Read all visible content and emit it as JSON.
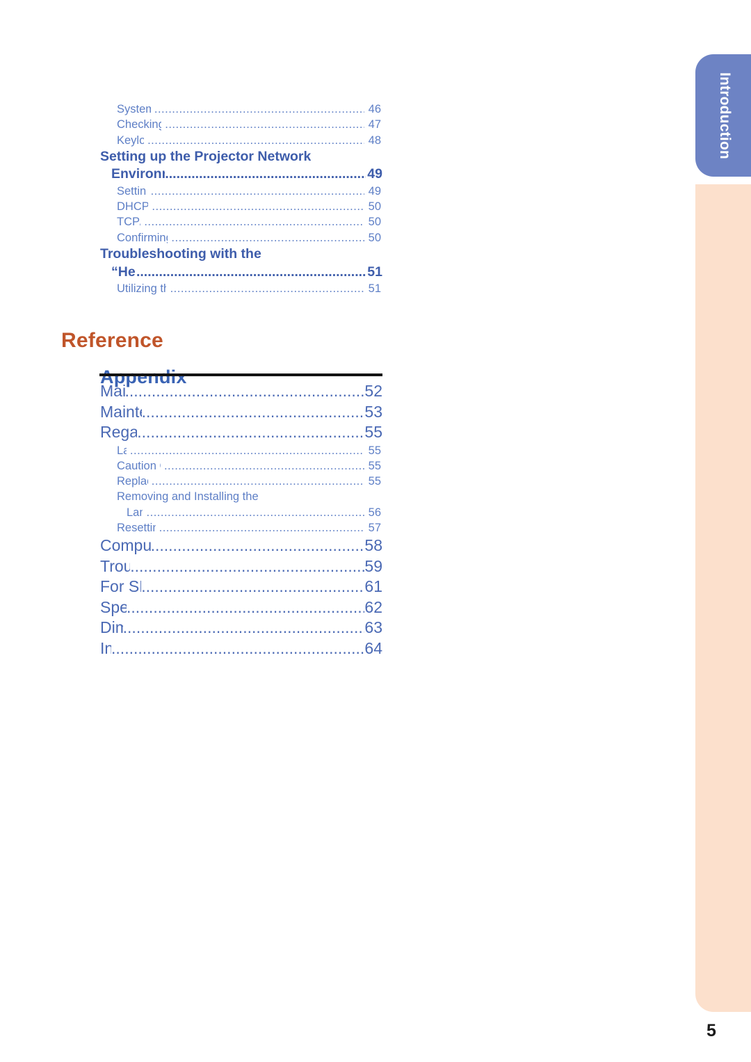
{
  "page": {
    "number": "5",
    "tab_label": "Introduction",
    "colors": {
      "tab_background": "#6d83c4",
      "side_band": "#fce0cc",
      "reference_heading": "#c0552a",
      "appendix_heading": "#3a63b4",
      "level1_bold": "#3e5dab",
      "level1_appendix": "#4a69b4",
      "level2": "#5e7fc6",
      "rule": "#141414"
    }
  },
  "headings": {
    "reference": "Reference",
    "appendix": "Appendix"
  },
  "toc": {
    "upper_entries": [
      {
        "level": 2,
        "title": "System Lock Function",
        "page": "46"
      },
      {
        "level": 2,
        "title": "Checking the Lamp Life Status",
        "page": "47"
      },
      {
        "level": 2,
        "title": "Keylock Function",
        "page": "48"
      },
      {
        "level": 1,
        "title": "Setting up the Projector Network",
        "page": "",
        "wrap_first": true
      },
      {
        "level": 1,
        "title": "Environment (“Network” Menu)",
        "page": "49",
        "continuation": true
      },
      {
        "level": 2,
        "title": "Setting a Password",
        "page": "49"
      },
      {
        "level": 2,
        "title": "DHCP Client Setting",
        "page": "50"
      },
      {
        "level": 2,
        "title": "TCP/IP Setting",
        "page": "50"
      },
      {
        "level": 2,
        "title": "Confirming the Projector Information",
        "page": "50"
      },
      {
        "level": 1,
        "title": "Troubleshooting with the",
        "page": "",
        "wrap_first": true
      },
      {
        "level": 1,
        "title": "“Help” Menu",
        "page": "51",
        "continuation": true
      },
      {
        "level": 2,
        "title": "Utilizing the “Help” Menu Functions",
        "page": "51"
      }
    ],
    "appendix_entries": [
      {
        "level": 1,
        "title": "Maintenance",
        "page": "52"
      },
      {
        "level": 1,
        "title": "Maintenance Indicators",
        "page": "53"
      },
      {
        "level": 1,
        "title": "Regarding the Lamp",
        "page": "55"
      },
      {
        "level": 2,
        "title": "Lamp",
        "page": "55"
      },
      {
        "level": 2,
        "title": "Caution Concerning the Lamp",
        "page": "55"
      },
      {
        "level": 2,
        "title": "Replacing the Lamp",
        "page": "55"
      },
      {
        "level": 2,
        "title": "Removing and Installing the",
        "page": "",
        "wrap_first": true
      },
      {
        "level": 2,
        "title": "Lamp Unit",
        "page": "56",
        "continuation": true
      },
      {
        "level": 2,
        "title": "Resetting the Lamp Timer",
        "page": "57"
      },
      {
        "level": 1,
        "title": "Computer Compatibility Chart",
        "page": "58"
      },
      {
        "level": 1,
        "title": "Troubleshooting",
        "page": "59"
      },
      {
        "level": 1,
        "title": "For SHARP Assistance",
        "page": "61"
      },
      {
        "level": 1,
        "title": "Specifications",
        "page": "62"
      },
      {
        "level": 1,
        "title": "Dimensions",
        "page": "63"
      },
      {
        "level": 1,
        "title": "Index",
        "page": "64"
      }
    ]
  }
}
